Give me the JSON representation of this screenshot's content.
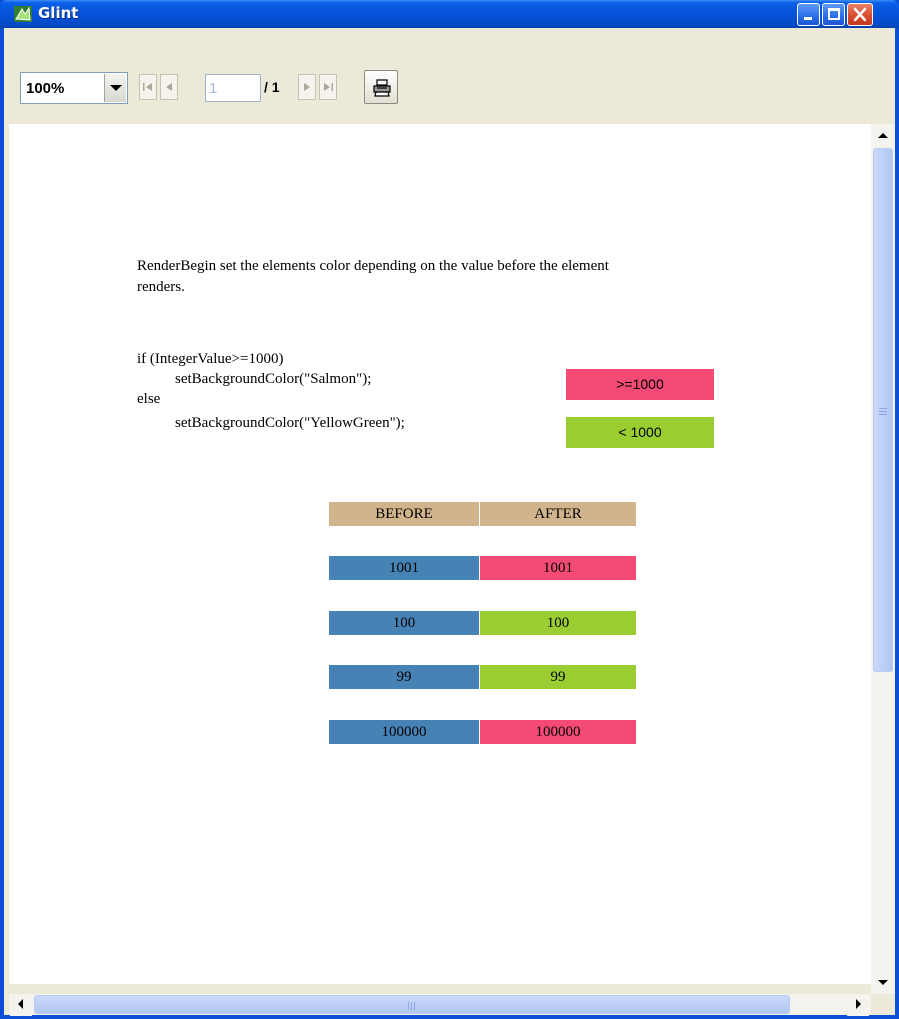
{
  "window": {
    "title": "Glint",
    "icon": "glint-app-icon"
  },
  "toolbar": {
    "zoom_value": "100%",
    "page_current": "1",
    "page_total": "/ 1",
    "icons": [
      "first-page-icon",
      "prev-page-icon",
      "next-page-icon",
      "last-page-icon",
      "print-icon"
    ]
  },
  "document": {
    "intro_line1": "RenderBegin set the elements color depending on the value before the element",
    "intro_line2": "renders.",
    "code_line1": "if (IntegerValue>=1000)",
    "code_line2": "setBackgroundColor(\"Salmon\");",
    "code_line3": "else",
    "code_line4": "setBackgroundColor(\"YellowGreen\");",
    "legend_high": ">=1000",
    "legend_low": "< 1000",
    "table": {
      "headers": [
        "BEFORE",
        "AFTER"
      ],
      "rows": [
        {
          "before": "1001",
          "after": "1001",
          "after_color": "#f44a76"
        },
        {
          "before": "100",
          "after": "100",
          "after_color": "#9acd32"
        },
        {
          "before": "99",
          "after": "99",
          "after_color": "#9acd32"
        },
        {
          "before": "100000",
          "after": "100000",
          "after_color": "#f44a76"
        }
      ]
    }
  },
  "colors": {
    "salmon": "#f44a76",
    "yellow_green": "#9acd32",
    "before_blue": "#4682b4",
    "header_tan": "#d2b48c",
    "title_bar_blue": "#0552d9"
  }
}
